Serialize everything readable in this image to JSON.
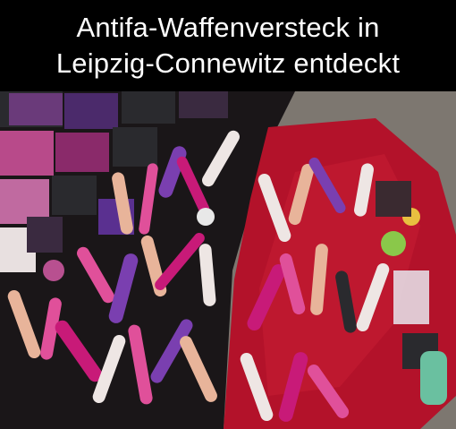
{
  "caption": {
    "line1": "Antifa-Waffenversteck in",
    "line2": "Leipzig-Connewitz entdeckt"
  },
  "photo": {
    "subject": "adult toys laid out on dark and red blankets",
    "palette": {
      "carpet": "#7d7770",
      "dark_blanket": "#1a1618",
      "red_blanket": "#b3122a",
      "box_purple": "#4b2a6b",
      "box_pink": "#b84a8a",
      "box_black": "#2a2a2e",
      "toy_pink": "#e0509a",
      "toy_purple": "#7a3fb0",
      "toy_skin": "#e8b49a",
      "toy_white": "#eee6e4",
      "toy_magenta": "#c81a78"
    }
  }
}
